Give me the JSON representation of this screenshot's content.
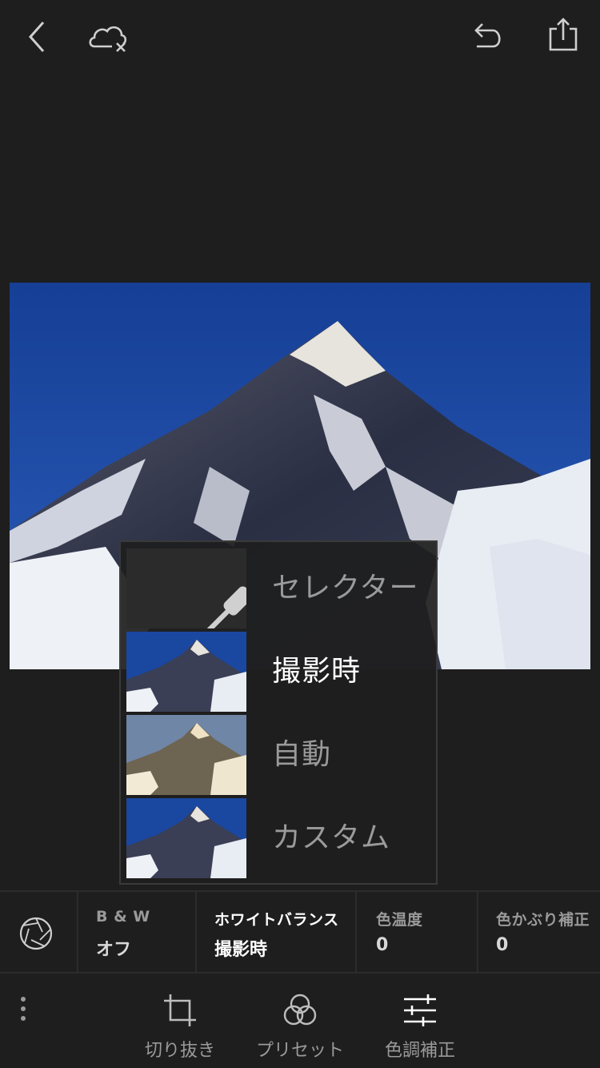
{
  "toolbar": {
    "back_icon": "chevron-left-icon",
    "cloud_icon": "cloud-off-icon",
    "undo_icon": "undo-icon",
    "share_icon": "share-icon"
  },
  "photo": {
    "subject": "snowy-mountain-peak"
  },
  "white_balance_menu": {
    "items": [
      {
        "label": "セレクター",
        "icon": "eyedropper-icon",
        "selected": false
      },
      {
        "label": "撮影時",
        "selected": true
      },
      {
        "label": "自動",
        "selected": false
      },
      {
        "label": "カスタム",
        "selected": false
      }
    ]
  },
  "params": {
    "aperture_icon": "aperture-icon",
    "bw": {
      "label": "B & W",
      "value": "オフ"
    },
    "wb": {
      "label": "ホワイトバランス",
      "value": "撮影時"
    },
    "temp": {
      "label": "色温度",
      "value": "0"
    },
    "tint": {
      "label": "色かぶり補正",
      "value": "0"
    }
  },
  "bottom": {
    "more_icon": "more-vertical-icon",
    "tools": [
      {
        "label": "切り抜き",
        "icon": "crop-icon"
      },
      {
        "label": "プリセット",
        "icon": "presets-icon"
      },
      {
        "label": "色調補正",
        "icon": "sliders-icon"
      }
    ]
  },
  "colors": {
    "background": "#1e1e1e",
    "sky": "#1a47a0",
    "text_active": "#ffffff",
    "text_inactive": "#9a9a9a"
  }
}
